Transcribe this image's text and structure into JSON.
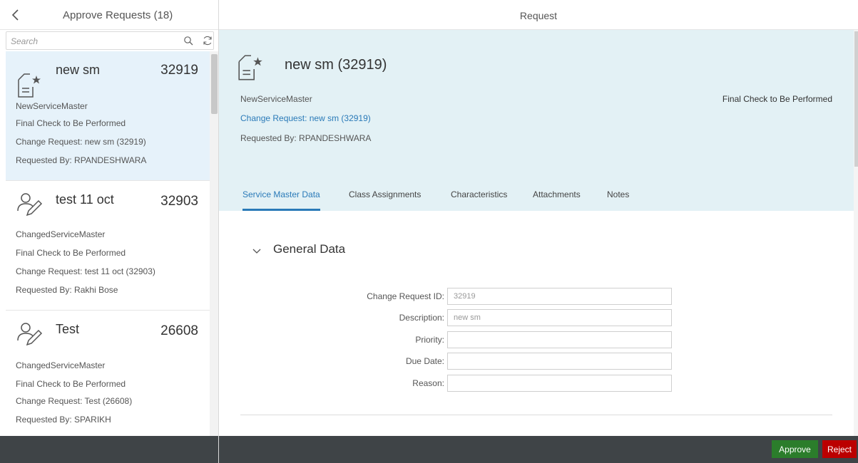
{
  "master": {
    "title": "Approve Requests (18)",
    "search_placeholder": "Search",
    "items": [
      {
        "title": "new sm",
        "number": "32919",
        "type": "NewServiceMaster",
        "status": "Final Check to Be Performed",
        "change_request": "Change Request: new sm (32919)",
        "requested_by": "Requested By: RPANDESHWARA",
        "icon": "new-document-icon"
      },
      {
        "title": "test 11 oct",
        "number": "32903",
        "type": "ChangedServiceMaster",
        "status": "Final Check to Be Performed",
        "change_request": "Change Request: test 11 oct (32903)",
        "requested_by": "Requested By: Rakhi Bose",
        "icon": "person-edit-icon"
      },
      {
        "title": "Test",
        "number": "26608",
        "type": "ChangedServiceMaster",
        "status": "Final Check to Be Performed",
        "change_request": "Change Request: Test (26608)",
        "requested_by": "Requested By: SPARIKH",
        "icon": "person-edit-icon"
      }
    ]
  },
  "detail": {
    "title": "Request",
    "header": {
      "title": "new sm (32919)",
      "type": "NewServiceMaster",
      "link": "Change Request: new sm (32919)",
      "requested_by": "Requested By: RPANDESHWARA",
      "status": "Final Check to Be Performed"
    },
    "tabs": [
      "Service Master Data",
      "Class Assignments",
      "Characteristics",
      "Attachments",
      "Notes"
    ],
    "section_title": "General Data",
    "form": [
      {
        "label": "Change Request ID:",
        "value": "32919"
      },
      {
        "label": "Description:",
        "value": "new sm"
      },
      {
        "label": "Priority:",
        "value": ""
      },
      {
        "label": "Due Date:",
        "value": ""
      },
      {
        "label": "Reason:",
        "value": ""
      }
    ]
  },
  "footer": {
    "approve_label": "Approve",
    "reject_label": "Reject"
  },
  "colors": {
    "accent": "#2a7ab8",
    "header_bg": "#e3f1f5",
    "selected_bg": "#e6f2fa",
    "footer_bg": "#3f4447",
    "approve": "#2b7d2b",
    "reject": "#bb0000"
  }
}
